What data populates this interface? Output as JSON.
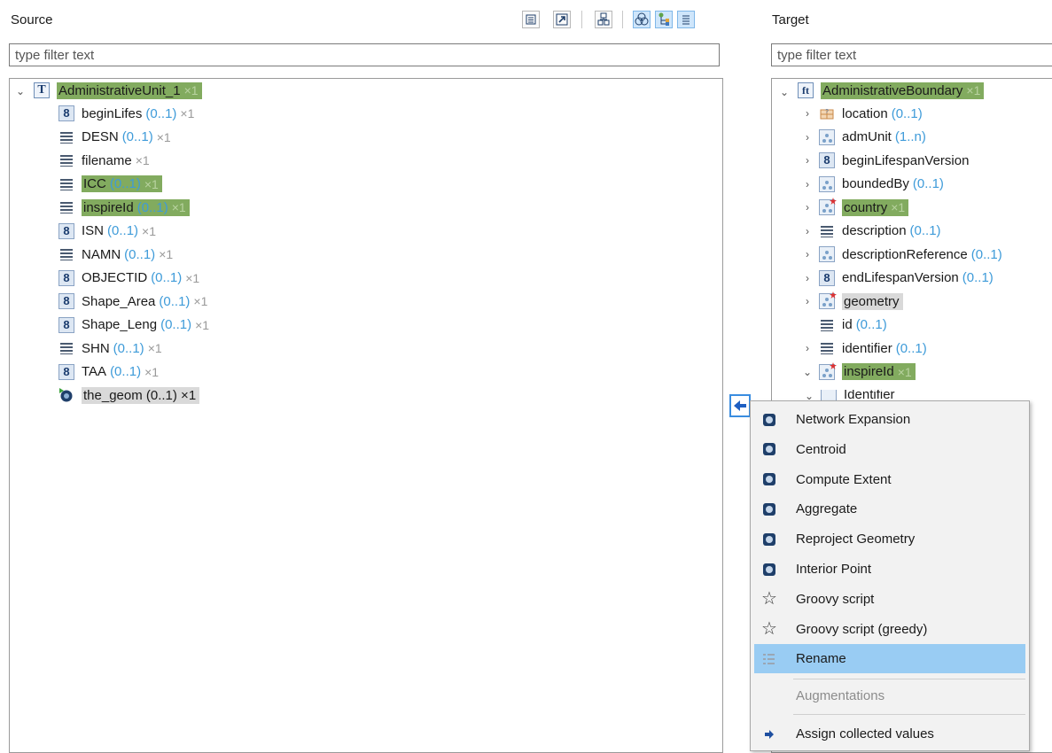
{
  "source": {
    "title": "Source",
    "filter_placeholder": "type filter text",
    "root": {
      "label": "AdministrativeUnit_1",
      "mult": "×1"
    },
    "items": [
      {
        "label": "beginLifes",
        "card": "(0..1)",
        "mult": "×1",
        "icon": "number-icon"
      },
      {
        "label": "DESN",
        "card": "(0..1)",
        "mult": "×1",
        "icon": "string-icon"
      },
      {
        "label": "filename",
        "card": "",
        "mult": "×1",
        "icon": "string-icon"
      },
      {
        "label": "ICC",
        "card": "(0..1)",
        "mult": "×1",
        "icon": "string-icon",
        "highlight": "green"
      },
      {
        "label": "inspireId",
        "card": "(0..1)",
        "mult": "×1",
        "icon": "string-icon",
        "highlight": "green"
      },
      {
        "label": "ISN",
        "card": "(0..1)",
        "mult": "×1",
        "icon": "number-icon"
      },
      {
        "label": "NAMN",
        "card": "(0..1)",
        "mult": "×1",
        "icon": "string-icon"
      },
      {
        "label": "OBJECTID",
        "card": "(0..1)",
        "mult": "×1",
        "icon": "number-icon"
      },
      {
        "label": "Shape_Area",
        "card": "(0..1)",
        "mult": "×1",
        "icon": "number-icon"
      },
      {
        "label": "Shape_Leng",
        "card": "(0..1)",
        "mult": "×1",
        "icon": "number-icon"
      },
      {
        "label": "SHN",
        "card": "(0..1)",
        "mult": "×1",
        "icon": "string-icon"
      },
      {
        "label": "TAA",
        "card": "(0..1)",
        "mult": "×1",
        "icon": "number-icon"
      },
      {
        "label": "the_geom (0..1) ×1",
        "card": "",
        "mult": "",
        "icon": "geometry-icon",
        "highlight": "grey"
      }
    ]
  },
  "target": {
    "title": "Target",
    "filter_placeholder": "type filter text",
    "root": {
      "label": "AdministrativeBoundary",
      "mult": "×1"
    },
    "items": [
      {
        "label": "location",
        "card": "(0..1)",
        "mult": "",
        "icon": "location-icon",
        "expander": ">"
      },
      {
        "label": "admUnit",
        "card": "(1..n)",
        "mult": "",
        "icon": "group-icon",
        "expander": ">"
      },
      {
        "label": "beginLifespanVersion",
        "card": "",
        "mult": "",
        "icon": "number-icon",
        "expander": ">"
      },
      {
        "label": "boundedBy",
        "card": "(0..1)",
        "mult": "",
        "icon": "group-icon",
        "expander": ">"
      },
      {
        "label": "country",
        "card": "",
        "mult": "×1",
        "icon": "group-star-icon",
        "expander": ">",
        "highlight": "green"
      },
      {
        "label": "description",
        "card": "(0..1)",
        "mult": "",
        "icon": "string-icon",
        "expander": ">"
      },
      {
        "label": "descriptionReference",
        "card": "(0..1)",
        "mult": "",
        "icon": "group-icon",
        "expander": ">"
      },
      {
        "label": "endLifespanVersion",
        "card": "(0..1)",
        "mult": "",
        "icon": "number-icon",
        "expander": ">"
      },
      {
        "label": "geometry",
        "card": "",
        "mult": "",
        "icon": "group-star-icon",
        "expander": ">",
        "highlight": "grey"
      },
      {
        "label": "id",
        "card": "(0..1)",
        "mult": "",
        "icon": "string-icon",
        "expander": ""
      },
      {
        "label": "identifier",
        "card": "(0..1)",
        "mult": "",
        "icon": "string-icon",
        "expander": ">"
      },
      {
        "label": "inspireId",
        "card": "",
        "mult": "×1",
        "icon": "group-star-icon",
        "expander": "v",
        "highlight": "green"
      }
    ],
    "partial_item": "Identifier"
  },
  "context_menu": {
    "items": [
      {
        "label": "Network Expansion",
        "icon": "function-icon"
      },
      {
        "label": "Centroid",
        "icon": "function-icon"
      },
      {
        "label": "Compute Extent",
        "icon": "function-icon"
      },
      {
        "label": "Aggregate",
        "icon": "function-icon"
      },
      {
        "label": "Reproject Geometry",
        "icon": "function-icon"
      },
      {
        "label": "Interior Point",
        "icon": "function-icon"
      },
      {
        "label": "Groovy script",
        "icon": "star-icon"
      },
      {
        "label": "Groovy script (greedy)",
        "icon": "star-icon"
      },
      {
        "label": "Rename",
        "icon": "list-icon",
        "selected": true
      }
    ],
    "augmentations_label": "Augmentations",
    "assign_label": "Assign collected values"
  },
  "colors": {
    "highlight_green": "#82ab5f",
    "highlight_grey": "#d9d9d9",
    "card_blue": "#3e9bd9",
    "menu_selected": "#99ccf3"
  }
}
